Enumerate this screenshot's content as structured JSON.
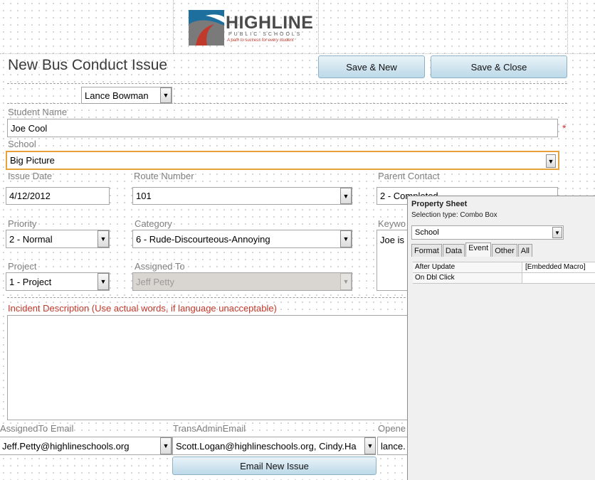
{
  "logo": {
    "title": "HIGHLINE",
    "subtitle": "PUBLIC SCHOOLS",
    "tagline": "A path to success for every student"
  },
  "form": {
    "title": "New Bus Conduct Issue",
    "save_new_label": "Save & New",
    "save_close_label": "Save & Close",
    "reporter_value": "Lance Bowman",
    "student_name_label": "Student Name",
    "student_name_value": "Joe Cool",
    "required_marker": "*",
    "school_label": "School",
    "school_value": "Big Picture",
    "issue_date_label": "Issue Date",
    "issue_date_value": "4/12/2012",
    "route_number_label": "Route Number",
    "route_number_value": "101",
    "parent_contact_label": "Parent Contact",
    "parent_contact_value": "2 - Completed",
    "priority_label": "Priority",
    "priority_value": "2 - Normal",
    "category_label": "Category",
    "category_value": "6 - Rude-Discourteous-Annoying",
    "keywords_label": "Keywo",
    "keywords_value": "Joe is",
    "project_label": "Project",
    "project_value": "1 - Project",
    "assigned_to_label": "Assigned To",
    "assigned_to_value": "Jeff Petty",
    "incident_label": "Incident Description (Use actual words, if language unacceptable)",
    "assignedto_email_label": "AssignedTo Email",
    "assignedto_email_value": "Jeff.Petty@highlineschools.org",
    "transadmin_email_label": "TransAdminEmail",
    "transadmin_email_value": "Scott.Logan@highlineschools.org, Cindy.Ha",
    "opened_label": "Opene",
    "opened_value": "lance.",
    "email_button_label": "Email New Issue"
  },
  "property_sheet": {
    "title": "Property Sheet",
    "selection_type": "Selection type:  Combo Box",
    "object_value": "School",
    "tabs": [
      "Format",
      "Data",
      "Event",
      "Other",
      "All"
    ],
    "active_tab": "Event",
    "rows": [
      {
        "key": "After Update",
        "value": "[Embedded Macro]"
      },
      {
        "key": "On Dbl Click",
        "value": ""
      }
    ]
  },
  "colors": {
    "focus_border": "#e9a23b",
    "required": "#d0312d",
    "incident_label": "#c0392b",
    "button_top": "#e9f3f8",
    "button_bottom": "#bcd9e8"
  }
}
